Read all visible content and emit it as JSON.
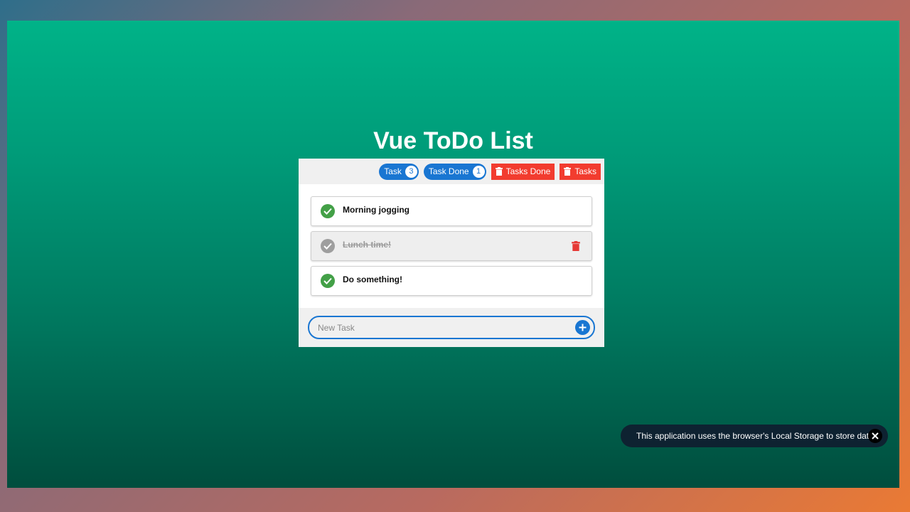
{
  "app": {
    "title": "Vue ToDo List"
  },
  "toolbar": {
    "task_label": "Task",
    "task_count": "3",
    "task_done_label": "Task Done",
    "task_done_count": "1",
    "clear_done_label": "Tasks Done",
    "clear_all_label": "Tasks"
  },
  "tasks": [
    {
      "label": "Morning jogging",
      "done": false
    },
    {
      "label": "Lunch time!",
      "done": true
    },
    {
      "label": "Do something!",
      "done": false
    }
  ],
  "new_task": {
    "placeholder": "New Task",
    "value": ""
  },
  "notice": {
    "text": "This application uses the browser's Local Storage to store data"
  },
  "colors": {
    "primary": "#1976d2",
    "danger": "#f23c2f",
    "success": "#43a047",
    "muted": "#9e9e9e"
  },
  "icons": {
    "check": "check-icon",
    "trash": "trash-icon",
    "add": "plus-icon",
    "close": "close-icon"
  }
}
